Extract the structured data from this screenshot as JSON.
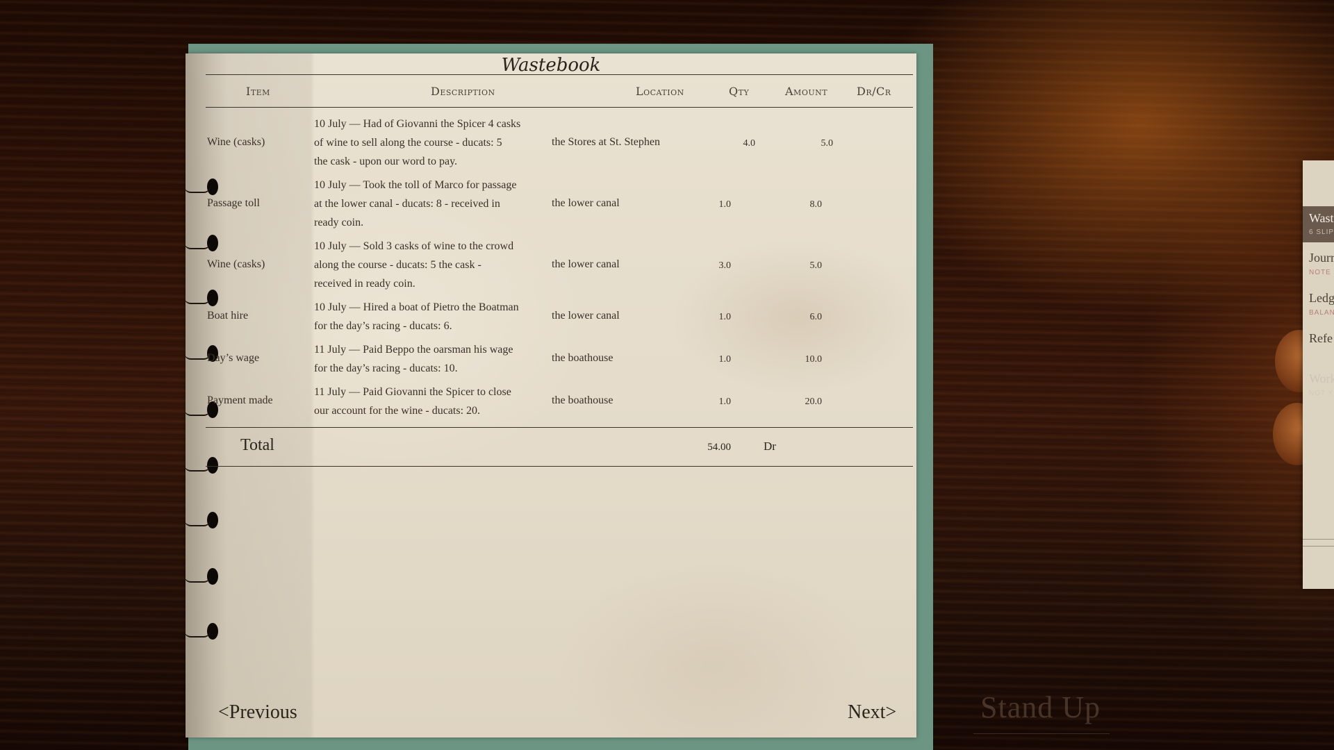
{
  "book": {
    "title": "Wastebook",
    "columns": [
      "Item",
      "Description",
      "Location",
      "Qty",
      "Amount",
      "Dr/Cr"
    ],
    "rows": [
      {
        "item": "Wine (casks)",
        "description": [
          "10 July — Had of Giovanni the Spicer 4 casks",
          "of wine to sell along the course - ducats: 5",
          "the cask - upon our word to pay."
        ],
        "location": "the Stores at St. Stephen",
        "qty": "4.0",
        "amount": "5.0"
      },
      {
        "item": "Passage toll",
        "description": [
          "10 July — Took the toll of Marco for passage",
          "at the lower canal - ducats: 8 - received in",
          "ready coin."
        ],
        "location": "the lower canal",
        "qty": "1.0",
        "amount": "8.0"
      },
      {
        "item": "Wine (casks)",
        "description": [
          "10 July — Sold 3 casks of wine to the crowd",
          "along the course - ducats: 5 the cask -",
          "received in ready coin."
        ],
        "location": "the lower canal",
        "qty": "3.0",
        "amount": "5.0"
      },
      {
        "item": "Boat hire",
        "description": [
          "10 July — Hired a boat of Pietro the Boatman",
          "for the day’s racing - ducats: 6."
        ],
        "location": "the lower canal",
        "qty": "1.0",
        "amount": "6.0"
      },
      {
        "item": "Day’s wage",
        "description": [
          "11 July — Paid Beppo the oarsman his wage",
          "for the day’s racing - ducats: 10."
        ],
        "location": "the boathouse",
        "qty": "1.0",
        "amount": "10.0"
      },
      {
        "item": "Payment made",
        "description": [
          "11 July — Paid Giovanni the Spicer to close",
          "our account for the wine - ducats: 20."
        ],
        "location": "the boathouse",
        "qty": "1.0",
        "amount": "20.0"
      }
    ],
    "total": {
      "label": "Total",
      "value": "54.00",
      "drcr": "Dr"
    },
    "nav": {
      "previous": "<Previous",
      "next": "Next>"
    }
  },
  "stand_up": "Stand Up",
  "tabs": [
    {
      "label": "Wast",
      "sub": "6 SLIP",
      "state": "active"
    },
    {
      "label": "Jourr",
      "sub": "NOTE",
      "state": "normal"
    },
    {
      "label": "Ledg",
      "sub": "BALAN",
      "state": "normal"
    },
    {
      "label": "Refe",
      "sub": "",
      "state": "normal"
    },
    {
      "label": "Work",
      "sub": "NOT Y",
      "state": "disabled"
    }
  ],
  "colors": {
    "page": "#e5dccb",
    "frame": "#6c9583",
    "ink": "#3a3027",
    "desk": "#2f1207"
  }
}
